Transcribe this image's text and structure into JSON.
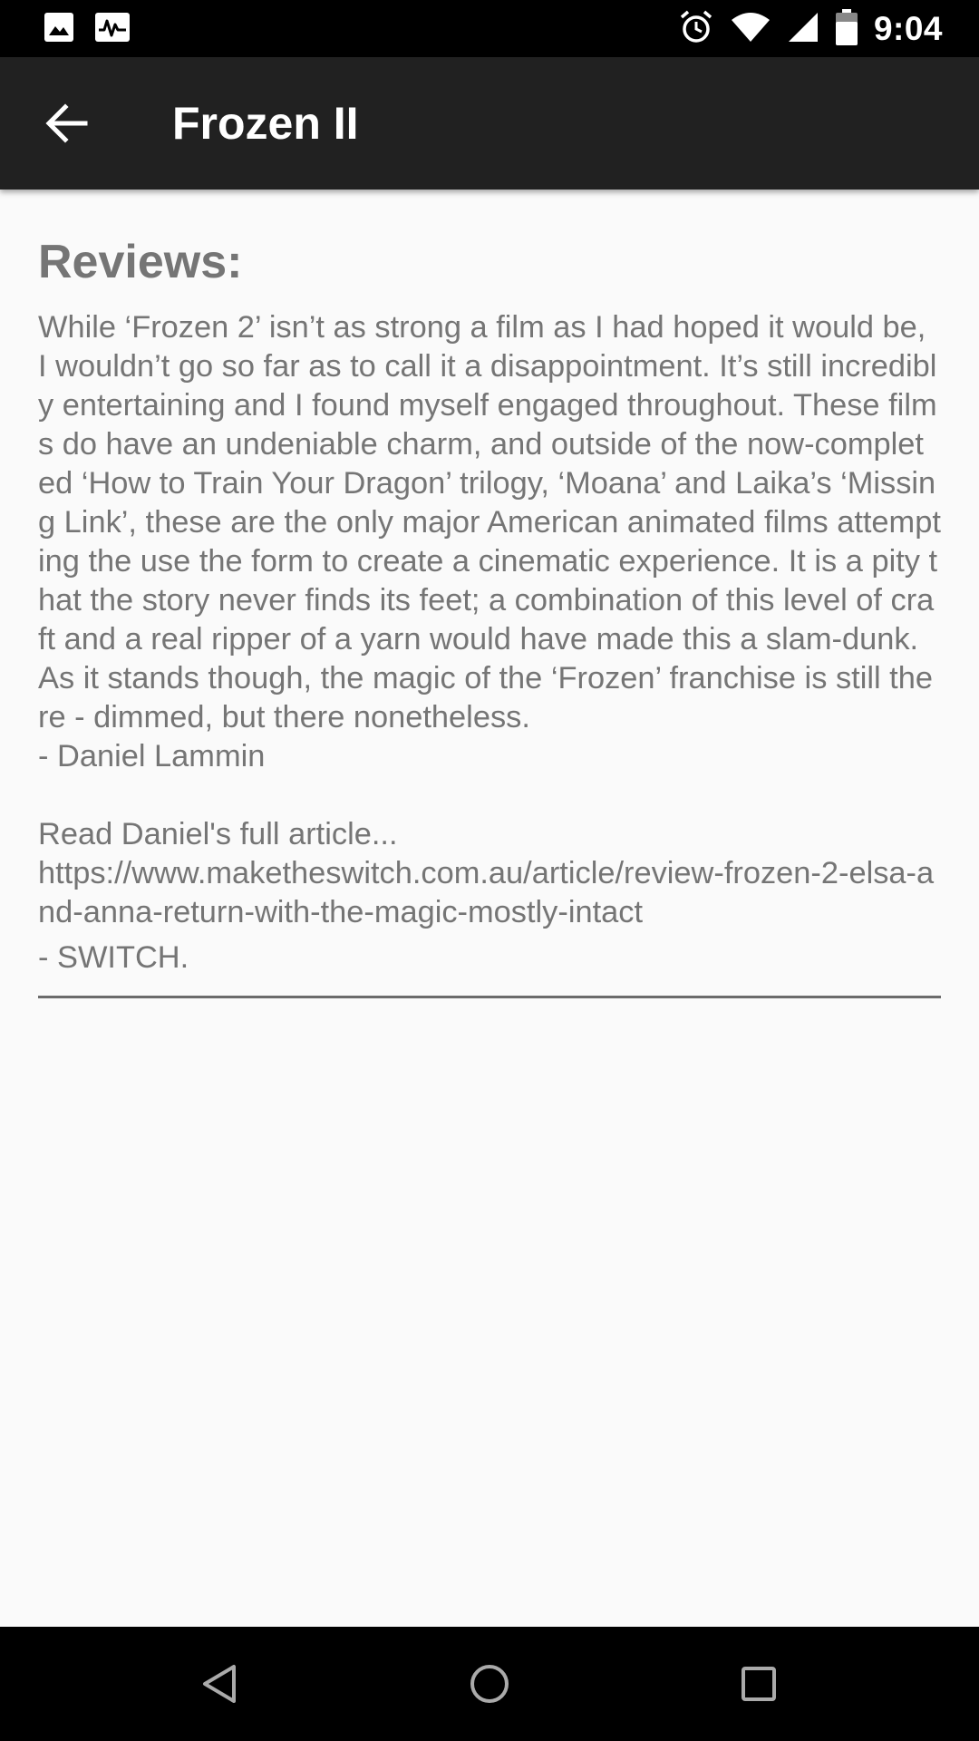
{
  "status_bar": {
    "time": "9:04",
    "left_icons": [
      "image-icon",
      "activity-icon"
    ],
    "right_icons": [
      "alarm-icon",
      "wifi-icon",
      "signal-icon",
      "battery-icon"
    ]
  },
  "app_bar": {
    "title": "Frozen II",
    "back_icon": "arrow-left-icon"
  },
  "reviews": {
    "heading": "Reviews:",
    "body": "While ‘Frozen 2’ isn’t as strong a film as I had hoped it would be, I wouldn’t go so far as to call it a disappointment. It’s still incredibly entertaining and I found myself engaged throughout. These films do have an undeniable charm, and outside of the now-completed ‘How to Train Your Dragon’ trilogy, ‘Moana’ and Laika’s ‘Missing Link’, these are the only major American animated films attempting the use the form to create a cinematic experience. It is a pity that the story never finds its feet; a combination of this level of craft and a real ripper of a yarn would have made this a slam-dunk. As it stands though, the magic of the ‘Frozen’ franchise is still there - dimmed, but there nonetheless.\n- Daniel Lammin\n\nRead Daniel's full article...\nhttps://www.maketheswitch.com.au/article/review-frozen-2-elsa-and-anna-return-with-the-magic-mostly-intact",
    "source": "- SWITCH."
  },
  "nav_bar": {
    "icons": [
      "nav-back-icon",
      "nav-home-icon",
      "nav-recents-icon"
    ]
  },
  "colors": {
    "app_bar": "#212121",
    "status_bar": "#000000",
    "background": "#fafafa",
    "text": "#757575"
  }
}
